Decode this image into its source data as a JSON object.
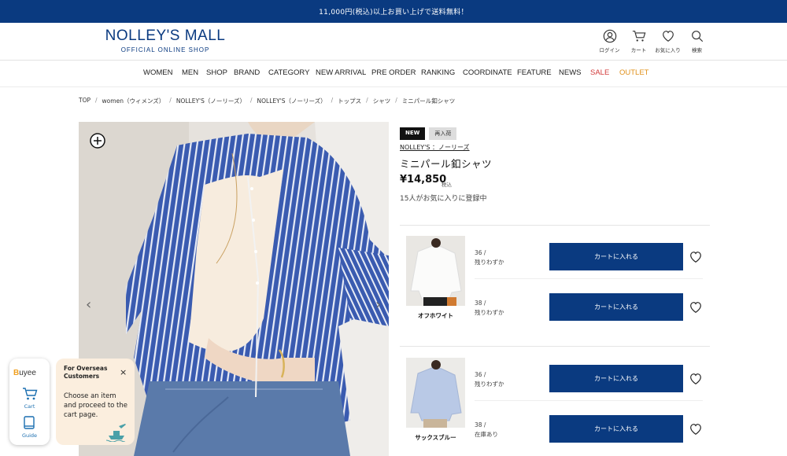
{
  "promo": "11,000円(税込)以上お買い上げで送料無料！",
  "logo": {
    "main": "NOLLEY'S MALL",
    "sub": "OFFICIAL ONLINE SHOP"
  },
  "header_icons": [
    {
      "name": "user-icon",
      "label": "ログイン"
    },
    {
      "name": "cart-icon",
      "label": "カート"
    },
    {
      "name": "heart-icon",
      "label": "お気に入り"
    },
    {
      "name": "search-icon",
      "label": "検索"
    }
  ],
  "nav": [
    "WOMEN",
    "MEN",
    "SHOP",
    "BRAND",
    "CATEGORY",
    "NEW ARRIVAL",
    "PRE ORDER",
    "RANKING",
    "COORDINATE",
    "FEATURE",
    "NEWS",
    "SALE",
    "OUTLET"
  ],
  "breadcrumb": [
    "TOP",
    "women（ウィメンズ）",
    "NOLLEY'S（ノーリーズ）",
    "NOLLEY'S（ノーリーズ）",
    "トップス",
    "シャツ",
    "ミニパール釦シャツ"
  ],
  "product": {
    "badge_new": "NEW",
    "badge_restock": "再入荷",
    "brand": "NOLLEY'S ：ノーリーズ",
    "title": "ミニパール釦シャツ",
    "price": "¥14,850",
    "tax_label": "税込",
    "favorites": "15人がお気に入りに登録中"
  },
  "variants": [
    {
      "color": "オフホワイト",
      "sizes": [
        {
          "size": "36 /",
          "stock": "残りわずか",
          "cart": "カートに入れる"
        },
        {
          "size": "38 /",
          "stock": "残りわずか",
          "cart": "カートに入れる"
        }
      ]
    },
    {
      "color": "サックスブルー",
      "sizes": [
        {
          "size": "36 /",
          "stock": "残りわずか",
          "cart": "カートに入れる"
        },
        {
          "size": "38 /",
          "stock": "在庫あり",
          "cart": "カートに入れる"
        }
      ]
    }
  ],
  "buyee": {
    "logo_a": "B",
    "logo_b": "uyee",
    "cart": "Cart",
    "guide": "Guide",
    "tip_title": "For Overseas Customers",
    "tip_body": "Choose an item and proceed to the cart page.",
    "close": "×"
  },
  "arrows": {
    "prev": "‹",
    "next": "›"
  },
  "colors": {
    "brand": "#0a3a80",
    "sale": "#d23b3b",
    "outlet": "#e0901a"
  }
}
